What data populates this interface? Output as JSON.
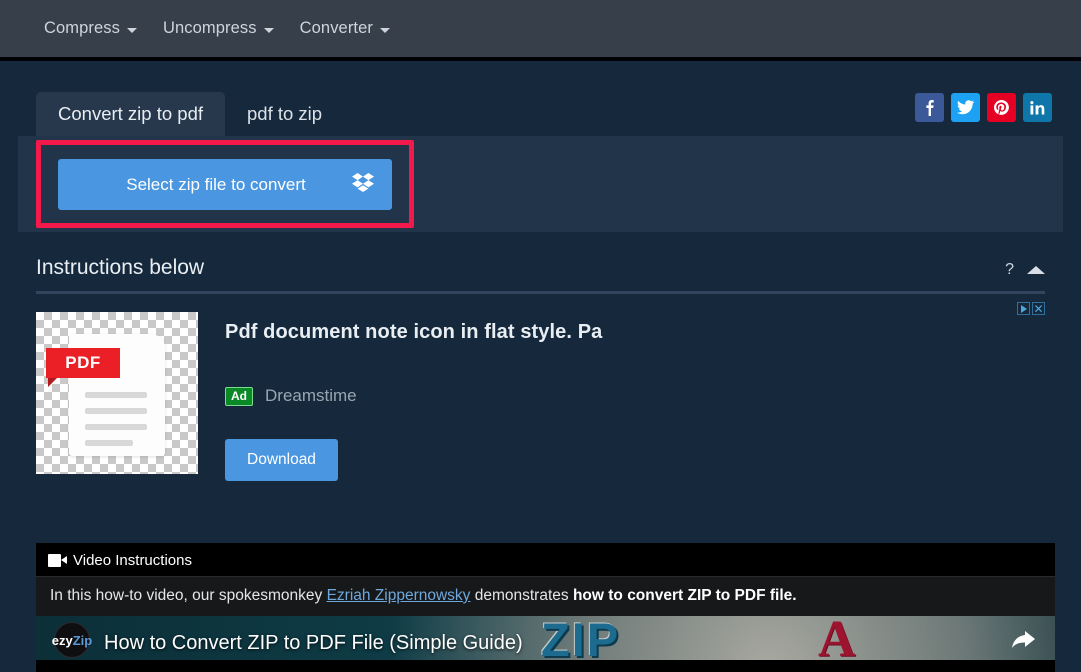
{
  "navbar": {
    "items": [
      {
        "label": "Compress",
        "icon": "chevron-down-icon"
      },
      {
        "label": "Uncompress",
        "icon": "chevron-down-icon"
      },
      {
        "label": "Converter",
        "icon": "chevron-down-icon"
      }
    ]
  },
  "tabs": [
    {
      "label": "Convert zip to pdf",
      "active": true
    },
    {
      "label": "pdf to zip",
      "active": false
    }
  ],
  "social": [
    {
      "name": "facebook",
      "glyph": "f",
      "color": "#3b5998"
    },
    {
      "name": "twitter",
      "glyph": "t",
      "color": "#1da1f2"
    },
    {
      "name": "pinterest",
      "glyph": "P",
      "color": "#e60023"
    },
    {
      "name": "linkedin",
      "glyph": "in",
      "color": "#0e76a8"
    }
  ],
  "upload": {
    "button_label": "Select zip file to convert",
    "dropbox_icon": "dropbox-icon",
    "highlight_color": "#f4194b",
    "button_color": "#4a96e0"
  },
  "instructions": {
    "title": "Instructions below",
    "help_icon": "?",
    "collapse_icon": "caret-up-icon"
  },
  "ad": {
    "headline": "Pdf document note icon in flat style. Pa",
    "badge": "Ad",
    "advertiser": "Dreamstime",
    "download_label": "Download",
    "thumb_label": "PDF",
    "adchoices_icon": "adchoices-icon",
    "close_icon": "✕"
  },
  "video": {
    "header": "Video Instructions",
    "camera_icon": "video-camera-icon",
    "description_parts": {
      "lead": "In this how-to video, our spokesmonkey ",
      "link": "Ezriah Zippernowsky",
      "mid": " demonstrates ",
      "bold": "how to convert ZIP to PDF file."
    },
    "player": {
      "title": "How to Convert ZIP to PDF File (Simple Guide)",
      "channel_logo_left": "ezy",
      "channel_logo_right": "Zip",
      "thumbnail_text_zip": "ZIP",
      "thumbnail_text_a": "A",
      "share_icon": "share-arrow-icon"
    }
  }
}
